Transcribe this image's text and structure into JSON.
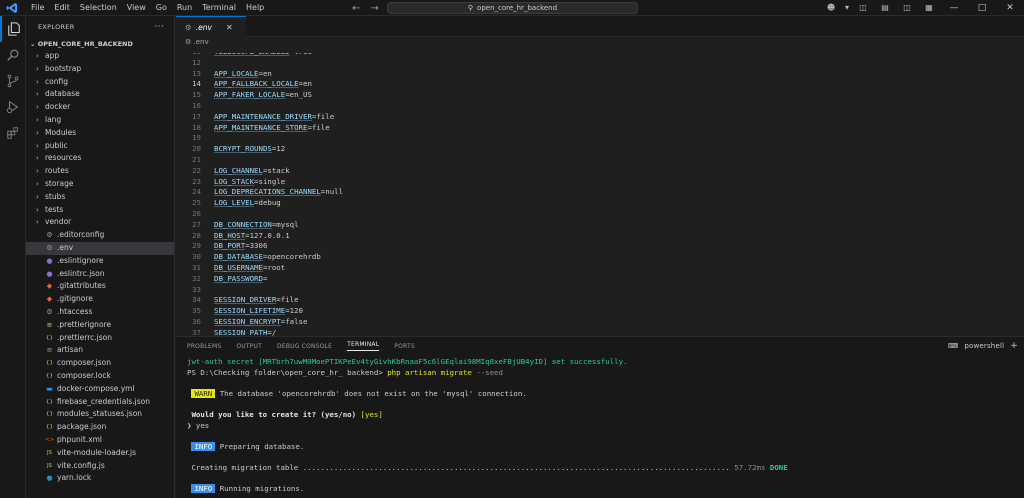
{
  "titlebar": {
    "menu": [
      "File",
      "Edit",
      "Selection",
      "View",
      "Go",
      "Run",
      "Terminal",
      "Help"
    ],
    "search_text": "open_core_hr_backend"
  },
  "sidebar": {
    "title": "EXPLORER",
    "root": "OPEN_CORE_HR_BACKEND",
    "items": [
      {
        "label": "app",
        "type": "folder"
      },
      {
        "label": "bootstrap",
        "type": "folder"
      },
      {
        "label": "config",
        "type": "folder"
      },
      {
        "label": "database",
        "type": "folder"
      },
      {
        "label": "docker",
        "type": "folder"
      },
      {
        "label": "lang",
        "type": "folder"
      },
      {
        "label": "Modules",
        "type": "folder"
      },
      {
        "label": "public",
        "type": "folder"
      },
      {
        "label": "resources",
        "type": "folder"
      },
      {
        "label": "routes",
        "type": "folder"
      },
      {
        "label": "storage",
        "type": "folder"
      },
      {
        "label": "stubs",
        "type": "folder"
      },
      {
        "label": "tests",
        "type": "folder"
      },
      {
        "label": "vendor",
        "type": "folder"
      },
      {
        "label": ".editorconfig",
        "type": "file",
        "icon": "gear",
        "color": "#9d9d9d"
      },
      {
        "label": ".env",
        "type": "file",
        "icon": "gear",
        "color": "#9d9d9d",
        "selected": true
      },
      {
        "label": ".eslintignore",
        "type": "file",
        "icon": "circle",
        "color": "#8a6fd1"
      },
      {
        "label": ".eslintrc.json",
        "type": "file",
        "icon": "circle",
        "color": "#8a6fd1"
      },
      {
        "label": ".gitattributes",
        "type": "file",
        "icon": "diamond",
        "color": "#e8662e"
      },
      {
        "label": ".gitignore",
        "type": "file",
        "icon": "diamond",
        "color": "#e8662e"
      },
      {
        "label": ".htaccess",
        "type": "file",
        "icon": "gear",
        "color": "#9d9d9d"
      },
      {
        "label": ".prettierignore",
        "type": "file",
        "icon": "list",
        "color": "#e5c07b"
      },
      {
        "label": ".prettierrc.json",
        "type": "file",
        "icon": "braces",
        "color": "#e5c07b"
      },
      {
        "label": "artisan",
        "type": "file",
        "icon": "list",
        "color": "#9d9d9d"
      },
      {
        "label": "composer.json",
        "type": "file",
        "icon": "braces",
        "color": "#e5c07b"
      },
      {
        "label": "composer.lock",
        "type": "file",
        "icon": "braces",
        "color": "#e5c07b"
      },
      {
        "label": "docker-compose.yml",
        "type": "file",
        "icon": "whale",
        "color": "#2496ed"
      },
      {
        "label": "firebase_credentials.json",
        "type": "file",
        "icon": "braces",
        "color": "#e5c07b"
      },
      {
        "label": "modules_statuses.json",
        "type": "file",
        "icon": "braces",
        "color": "#e5c07b"
      },
      {
        "label": "package.json",
        "type": "file",
        "icon": "braces",
        "color": "#e5c07b"
      },
      {
        "label": "phpunit.xml",
        "type": "file",
        "icon": "lt",
        "color": "#e8662e"
      },
      {
        "label": "vite-module-loader.js",
        "type": "file",
        "icon": "js",
        "color": "#cbcb41"
      },
      {
        "label": "vite.config.js",
        "type": "file",
        "icon": "js",
        "color": "#cbcb41"
      },
      {
        "label": "yarn.lock",
        "type": "file",
        "icon": "yarn",
        "color": "#2c8ebb"
      }
    ]
  },
  "editor": {
    "tab_label": ".env",
    "breadcrumb": ".env",
    "lines": [
      {
        "n": "11",
        "key": "TELESCOPE_ENABLED",
        "val": "=true"
      },
      {
        "n": "12",
        "key": "",
        "val": ""
      },
      {
        "n": "13",
        "key": "APP_LOCALE",
        "val": "=en"
      },
      {
        "n": "14",
        "key": "APP_FALLBACK_LOCALE",
        "val": "=en",
        "current": true
      },
      {
        "n": "15",
        "key": "APP_FAKER_LOCALE",
        "val": "=en_US"
      },
      {
        "n": "16",
        "key": "",
        "val": ""
      },
      {
        "n": "17",
        "key": "APP_MAINTENANCE_DRIVER",
        "val": "=file"
      },
      {
        "n": "18",
        "key": "APP_MAINTENANCE_STORE",
        "val": "=file"
      },
      {
        "n": "19",
        "key": "",
        "val": ""
      },
      {
        "n": "20",
        "key": "BCRYPT_ROUNDS",
        "val": "=12"
      },
      {
        "n": "21",
        "key": "",
        "val": ""
      },
      {
        "n": "22",
        "key": "LOG_CHANNEL",
        "val": "=stack"
      },
      {
        "n": "23",
        "key": "LOG_STACK",
        "val": "=single"
      },
      {
        "n": "24",
        "key": "LOG_DEPRECATIONS_CHANNEL",
        "val": "=null"
      },
      {
        "n": "25",
        "key": "LOG_LEVEL",
        "val": "=debug"
      },
      {
        "n": "26",
        "key": "",
        "val": ""
      },
      {
        "n": "27",
        "key": "DB_CONNECTION",
        "val": "=mysql"
      },
      {
        "n": "28",
        "key": "DB_HOST",
        "val": "=127.0.0.1"
      },
      {
        "n": "29",
        "key": "DB_PORT",
        "val": "=3306"
      },
      {
        "n": "30",
        "key": "DB_DATABASE",
        "val": "=opencorehrdb"
      },
      {
        "n": "31",
        "key": "DB_USERNAME",
        "val": "=root"
      },
      {
        "n": "32",
        "key": "DB_PASSWORD",
        "val": "="
      },
      {
        "n": "33",
        "key": "",
        "val": ""
      },
      {
        "n": "34",
        "key": "SESSION_DRIVER",
        "val": "=file"
      },
      {
        "n": "35",
        "key": "SESSION_LIFETIME",
        "val": "=120"
      },
      {
        "n": "36",
        "key": "SESSION_ENCRYPT",
        "val": "=false"
      },
      {
        "n": "37",
        "key": "SESSION_PATH",
        "val": "=/"
      }
    ]
  },
  "panel": {
    "tabs": [
      "PROBLEMS",
      "OUTPUT",
      "DEBUG CONSOLE",
      "TERMINAL",
      "PORTS"
    ],
    "active_tab": "TERMINAL",
    "shell": "powershell",
    "terminal": {
      "l1": "jwt-auth secret [MRTbrh7uwM0MoePTIKPeEv4tyGivhKbRnaaF5c6lGEqlai98MIq8xeFBjUB4yID] set successfully.",
      "l2_prompt": "PS D:\\Checking folder\\open_core_hr_ backend> ",
      "l2_cmd": "php artisan migrate ",
      "l2_arg": "--seed",
      "warn_badge": "WARN",
      "warn_text": " The database 'opencorehrdb' does not exist on the 'mysql' connection.",
      "q_text": "Would you like to create it? (yes/no) ",
      "q_default": "[yes]",
      "answer": "❯ yes",
      "info_badge": "INFO",
      "info1": " Preparing database.",
      "creating": "Creating migration table ................................................................................................ ",
      "creating_time": "57.72ms ",
      "creating_status": "DONE",
      "info2": " Running migrations."
    }
  }
}
